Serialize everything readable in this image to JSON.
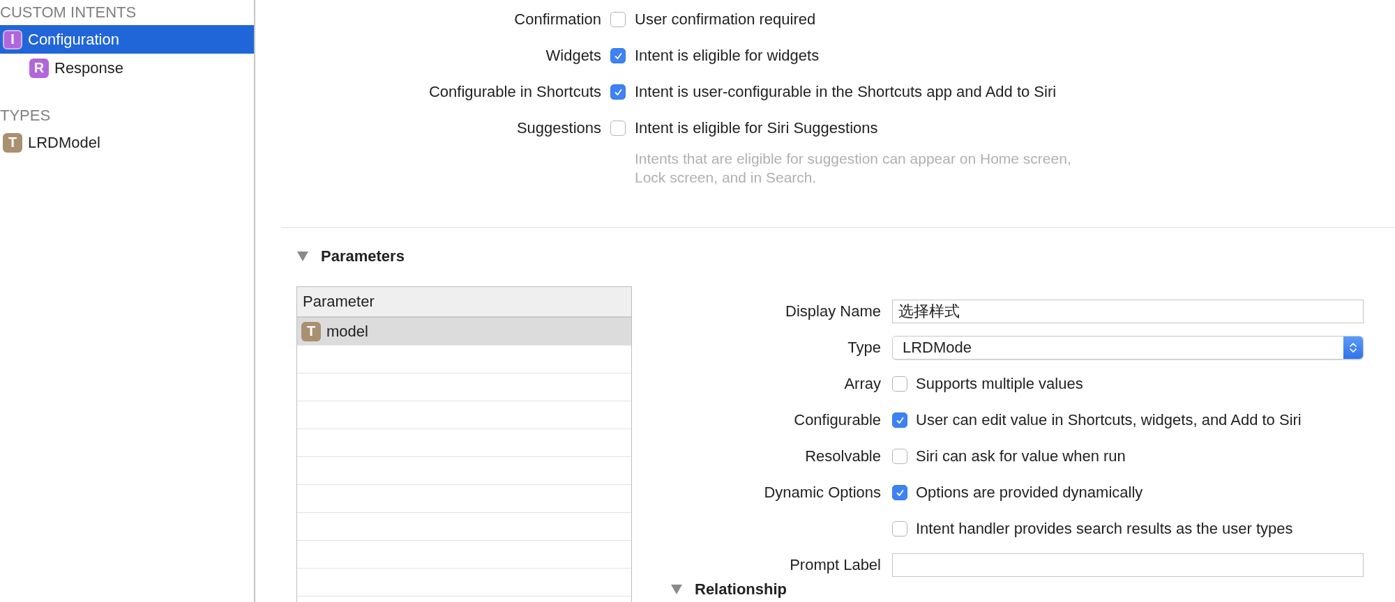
{
  "sidebar": {
    "sections": [
      {
        "title": "CUSTOM INTENTS",
        "items": [
          {
            "badge": "I",
            "color": "#b266dd",
            "label": "Configuration",
            "selected": true,
            "children": [
              {
                "badge": "R",
                "color": "#b266dd",
                "label": "Response",
                "selected": false
              }
            ]
          }
        ]
      },
      {
        "title": "TYPES",
        "items": [
          {
            "badge": "T",
            "color": "#a89070",
            "label": "LRDModel",
            "selected": false
          }
        ]
      }
    ]
  },
  "intent_options": [
    {
      "label": "Confirmation",
      "text": "User confirmation required",
      "checked": false
    },
    {
      "label": "Widgets",
      "text": "Intent is eligible for widgets",
      "checked": true
    },
    {
      "label": "Configurable in Shortcuts",
      "text": "Intent is user-configurable in the Shortcuts app and Add to Siri",
      "checked": true
    },
    {
      "label": "Suggestions",
      "text": "Intent is eligible for Siri Suggestions",
      "checked": false,
      "hint": "Intents that are eligible for suggestion can appear on Home screen,\nLock screen, and in Search."
    }
  ],
  "parameters": {
    "title": "Parameters",
    "expanded": true,
    "table": {
      "column": "Parameter",
      "rows": [
        {
          "badge": "T",
          "color": "#a89070",
          "label": "model",
          "selected": true
        }
      ]
    },
    "fields": [
      {
        "kind": "text",
        "label": "Display Name",
        "value": "选择样式"
      },
      {
        "kind": "popup",
        "label": "Type",
        "value": "LRDMode"
      },
      {
        "kind": "checkbox",
        "label": "Array",
        "text": "Supports multiple values",
        "checked": false
      },
      {
        "kind": "checkbox",
        "label": "Configurable",
        "text": "User can edit value in Shortcuts, widgets, and Add to Siri",
        "checked": true
      },
      {
        "kind": "checkbox",
        "label": "Resolvable",
        "text": "Siri can ask for value when run",
        "checked": false
      },
      {
        "kind": "checkbox",
        "label": "Dynamic Options",
        "text": "Options are provided dynamically",
        "checked": true
      },
      {
        "kind": "checkbox",
        "text": "Intent handler provides search results as the user types",
        "checked": false
      },
      {
        "kind": "text",
        "label": "Prompt Label"
      }
    ]
  },
  "relationship": {
    "title": "Relationship",
    "expanded": true
  }
}
